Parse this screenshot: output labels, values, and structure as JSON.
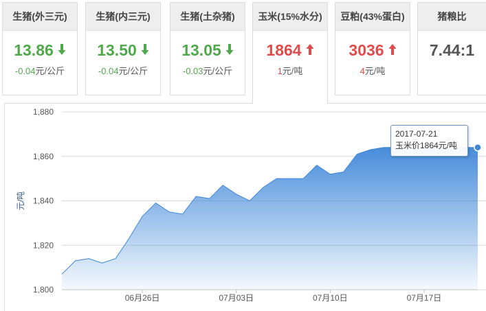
{
  "cards": [
    {
      "label": "生猪(外三元)",
      "price": "13.86",
      "change": "-0.04",
      "unit": "元/公斤",
      "trend": "down"
    },
    {
      "label": "生猪(内三元)",
      "price": "13.50",
      "change": "-0.04",
      "unit": "元/公斤",
      "trend": "down"
    },
    {
      "label": "生猪(土杂猪)",
      "price": "13.05",
      "change": "-0.03",
      "unit": "元/公斤",
      "trend": "down"
    },
    {
      "label": "玉米(15%水分)",
      "price": "1864",
      "change": "1",
      "unit": "元/吨",
      "trend": "up"
    },
    {
      "label": "豆粕(43%蛋白)",
      "price": "3036",
      "change": "4",
      "unit": "元/吨",
      "trend": "up"
    },
    {
      "label": "猪粮比",
      "price": "7.44:1",
      "change": "",
      "unit": "",
      "trend": "none"
    }
  ],
  "active_card_index": 3,
  "colors": {
    "up": "#e24b4b",
    "down": "#4fa84a",
    "series": "#3d86d8"
  },
  "tooltip": {
    "date": "2017-07-21",
    "text": "玉米价1864元/吨"
  },
  "chart_data": {
    "type": "area",
    "ylabel": "元/吨",
    "ylim": [
      1800,
      1880
    ],
    "yticks": [
      1800,
      1820,
      1840,
      1860,
      1880
    ],
    "ytick_labels": [
      "1,800",
      "1,820",
      "1,840",
      "1,860",
      "1,880"
    ],
    "x_tick_labels": [
      "06月26日",
      "07月03日",
      "07月10日",
      "07月17日"
    ],
    "x_tick_dates": [
      "2017-06-26",
      "2017-07-03",
      "2017-07-10",
      "2017-07-17"
    ],
    "grid": true,
    "x": [
      "2017-06-20",
      "2017-06-21",
      "2017-06-22",
      "2017-06-23",
      "2017-06-24",
      "2017-06-25",
      "2017-06-26",
      "2017-06-27",
      "2017-06-28",
      "2017-06-29",
      "2017-06-30",
      "2017-07-01",
      "2017-07-02",
      "2017-07-03",
      "2017-07-04",
      "2017-07-05",
      "2017-07-06",
      "2017-07-07",
      "2017-07-08",
      "2017-07-09",
      "2017-07-10",
      "2017-07-11",
      "2017-07-12",
      "2017-07-13",
      "2017-07-14",
      "2017-07-15",
      "2017-07-16",
      "2017-07-17",
      "2017-07-18",
      "2017-07-19",
      "2017-07-20",
      "2017-07-21"
    ],
    "values": [
      1807,
      1813,
      1814,
      1812,
      1814,
      1823,
      1833,
      1839,
      1835,
      1834,
      1842,
      1841,
      1847,
      1843,
      1840,
      1846,
      1850,
      1850,
      1850,
      1856,
      1852,
      1853,
      1861,
      1863,
      1864,
      1864,
      1864,
      1864,
      1864,
      1864,
      1864,
      1864
    ]
  }
}
